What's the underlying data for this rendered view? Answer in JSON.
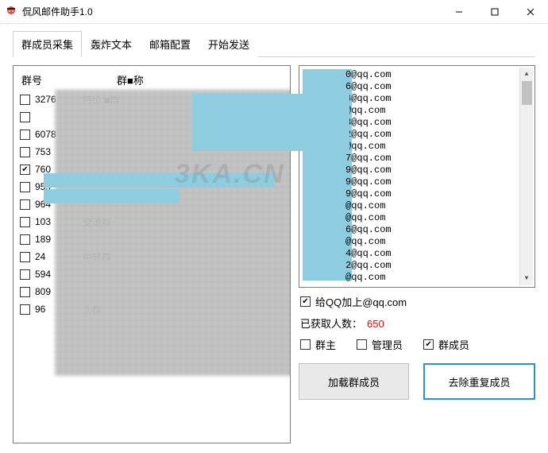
{
  "window": {
    "title": "侃风邮件助手1.0"
  },
  "tabs": [
    {
      "label": "群成员采集",
      "active": true
    },
    {
      "label": "轰炸文本",
      "active": false
    },
    {
      "label": "邮箱配置",
      "active": false
    },
    {
      "label": "开始发送",
      "active": false
    }
  ],
  "group_list": {
    "header_id": "群号",
    "header_name": "群■称",
    "rows": [
      {
        "checked": false,
        "id": "3276",
        "name": "特价 ■群"
      },
      {
        "checked": false,
        "id": "",
        "name": ""
      },
      {
        "checked": false,
        "id": "6078",
        "name": ""
      },
      {
        "checked": false,
        "id": "753",
        "name": ""
      },
      {
        "checked": true,
        "id": "760",
        "name": ""
      },
      {
        "checked": false,
        "id": "959",
        "name": ""
      },
      {
        "checked": false,
        "id": "964",
        "name": ""
      },
      {
        "checked": false,
        "id": "103",
        "name": "交流群"
      },
      {
        "checked": false,
        "id": "189",
        "name": ""
      },
      {
        "checked": false,
        "id": "24",
        "name": "中转群"
      },
      {
        "checked": false,
        "id": "594",
        "name": ""
      },
      {
        "checked": false,
        "id": "809",
        "name": ""
      },
      {
        "checked": false,
        "id": "96",
        "name": "⑤群"
      }
    ]
  },
  "emails": [
    "0@qq.com",
    "6@qq.com",
    "4@qq.com",
    "@qq.com",
    "3@qq.com",
    "2@qq.com",
    "@qq.com",
    "7@qq.com",
    "9@qq.com",
    "9@qq.com",
    "9@qq.com",
    "@qq.com",
    "@qq.com",
    "6@qq.com",
    "@qq.com",
    "4@qq.com",
    "2@qq.com",
    "@qq.com"
  ],
  "options": {
    "append_suffix_label": "给QQ加上@qq.com",
    "append_suffix_checked": true,
    "count_label": "已获取人数：",
    "count_value": "650",
    "role_owner": "群主",
    "role_owner_checked": false,
    "role_admin": "管理员",
    "role_admin_checked": false,
    "role_member": "群成员",
    "role_member_checked": true
  },
  "buttons": {
    "load": "加载群成员",
    "dedupe": "去除重复成员"
  },
  "watermark": "3KA.CN"
}
